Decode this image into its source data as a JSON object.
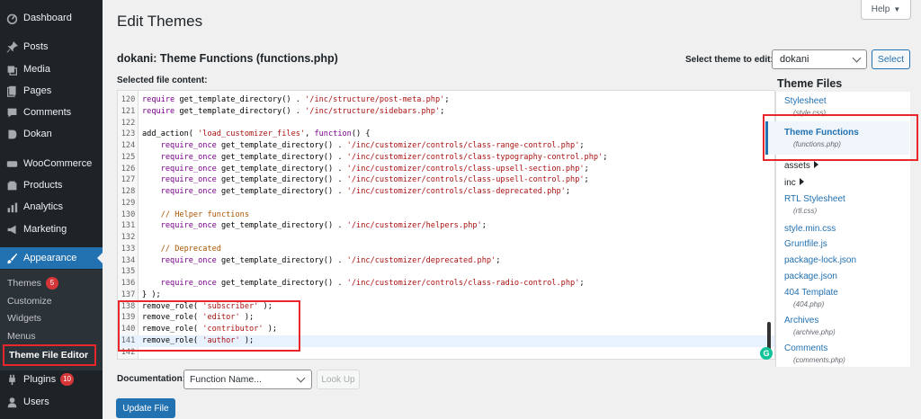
{
  "sidebar": {
    "items": [
      {
        "label": "Dashboard",
        "icon": "dashboard-icon"
      },
      {
        "label": "Posts",
        "icon": "pin-icon"
      },
      {
        "label": "Media",
        "icon": "media-icon"
      },
      {
        "label": "Pages",
        "icon": "pages-icon"
      },
      {
        "label": "Comments",
        "icon": "comment-icon"
      },
      {
        "label": "Dokan",
        "icon": "dokan-icon"
      },
      {
        "label": "WooCommerce",
        "icon": "woo-icon"
      },
      {
        "label": "Products",
        "icon": "products-icon"
      },
      {
        "label": "Analytics",
        "icon": "analytics-icon"
      },
      {
        "label": "Marketing",
        "icon": "megaphone-icon"
      },
      {
        "label": "Appearance",
        "icon": "brush-icon"
      },
      {
        "label": "Plugins",
        "icon": "plugin-icon",
        "badge": "10"
      },
      {
        "label": "Users",
        "icon": "users-icon"
      }
    ],
    "submenu": [
      {
        "label": "Themes",
        "badge": "5"
      },
      {
        "label": "Customize"
      },
      {
        "label": "Widgets"
      },
      {
        "label": "Menus"
      },
      {
        "label": "Theme File Editor"
      }
    ]
  },
  "header": {
    "title": "Edit Themes",
    "help_label": "Help",
    "help_arrow": "▼"
  },
  "file": {
    "heading": "dokani: Theme Functions (functions.php)",
    "select_theme_label": "Select theme to edit:",
    "selected_theme": "dokani",
    "select_button": "Select",
    "selected_content_label": "Selected file content:"
  },
  "code_lines": [
    {
      "n": "120",
      "text": "require get_template_directory() . '/inc/structure/post-meta.php';"
    },
    {
      "n": "121",
      "text": "require get_template_directory() . '/inc/structure/sidebars.php';"
    },
    {
      "n": "122",
      "text": ""
    },
    {
      "n": "123",
      "text": "add_action( 'load_customizer_files', function() {"
    },
    {
      "n": "124",
      "text": "    require_once get_template_directory() . '/inc/customizer/controls/class-range-control.php';"
    },
    {
      "n": "125",
      "text": "    require_once get_template_directory() . '/inc/customizer/controls/class-typography-control.php';"
    },
    {
      "n": "126",
      "text": "    require_once get_template_directory() . '/inc/customizer/controls/class-upsell-section.php';"
    },
    {
      "n": "127",
      "text": "    require_once get_template_directory() . '/inc/customizer/controls/class-upsell-control.php';"
    },
    {
      "n": "128",
      "text": "    require_once get_template_directory() . '/inc/customizer/controls/class-deprecated.php';"
    },
    {
      "n": "129",
      "text": ""
    },
    {
      "n": "130",
      "text": "    // Helper functions"
    },
    {
      "n": "131",
      "text": "    require_once get_template_directory() . '/inc/customizer/helpers.php';"
    },
    {
      "n": "132",
      "text": ""
    },
    {
      "n": "133",
      "text": "    // Deprecated"
    },
    {
      "n": "134",
      "text": "    require_once get_template_directory() . '/inc/customizer/deprecated.php';"
    },
    {
      "n": "135",
      "text": ""
    },
    {
      "n": "136",
      "text": "    require_once get_template_directory() . '/inc/customizer/controls/class-radio-control.php';"
    },
    {
      "n": "137",
      "text": "} );"
    },
    {
      "n": "138",
      "text": "remove_role( 'subscriber' );"
    },
    {
      "n": "139",
      "text": "remove_role( 'editor' );"
    },
    {
      "n": "140",
      "text": "remove_role( 'contributor' );"
    },
    {
      "n": "141",
      "text": "remove_role( 'author' );"
    },
    {
      "n": "142",
      "text": ""
    }
  ],
  "theme_files": {
    "heading": "Theme Files",
    "items": [
      {
        "type": "file",
        "label": "Stylesheet",
        "sub": "(style.css)"
      },
      {
        "type": "file",
        "label": "Theme Functions",
        "sub": "(functions.php)",
        "active": true
      },
      {
        "type": "folder",
        "label": "assets"
      },
      {
        "type": "folder",
        "label": "inc"
      },
      {
        "type": "file",
        "label": "RTL Stylesheet",
        "sub": "(rtl.css)"
      },
      {
        "type": "file",
        "label": "style.min.css"
      },
      {
        "type": "file",
        "label": "Gruntfile.js"
      },
      {
        "type": "file",
        "label": "package-lock.json"
      },
      {
        "type": "file",
        "label": "package.json"
      },
      {
        "type": "file",
        "label": "404 Template",
        "sub": "(404.php)"
      },
      {
        "type": "file",
        "label": "Archives",
        "sub": "(archive.php)"
      },
      {
        "type": "file",
        "label": "Comments",
        "sub": "(comments.php)"
      }
    ]
  },
  "footer": {
    "doc_label": "Documentation:",
    "doc_select_value": "Function Name...",
    "lookup_button": "Look Up",
    "update_button": "Update File"
  },
  "colors": {
    "admin_sidebar": "#1d2327",
    "accent": "#2271b1",
    "highlight": "#e9262c"
  }
}
